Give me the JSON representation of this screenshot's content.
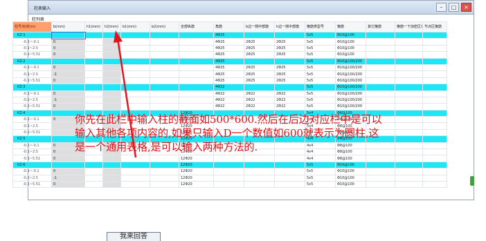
{
  "window": {
    "title": "柱表输入"
  },
  "table_caption": "柱列表",
  "columns": [
    "柱号/标高(m)",
    "b(mm)",
    "h1(mm)",
    "h2(mm)",
    "b1(mm)",
    "b2(mm)",
    "全部纵筋",
    "角筋",
    "b边一侧中部筋",
    "h边一侧中部筋",
    "箍筋类型号",
    "箍筋",
    "其它箍筋",
    "箍筋一下加密区长度",
    "节点区箍筋"
  ],
  "rows": [
    {
      "type": "group",
      "name": "KZ-1",
      "cells": [
        "",
        "",
        "",
        "",
        "",
        "",
        "4Φ25",
        "",
        "",
        "5x5",
        "Φ10@100"
      ]
    },
    {
      "type": "child",
      "name": "-0.1~-0.1",
      "cells": [
        "0",
        "",
        "",
        "",
        "",
        "",
        "4Φ25",
        "2Φ25",
        "2Φ25",
        "5x5",
        "Φ10@100"
      ]
    },
    {
      "type": "child",
      "name": "-0.1~2.5",
      "cells": [
        "0",
        "",
        "",
        "",
        "",
        "",
        "4Φ25",
        "2Φ25",
        "2Φ25",
        "5x5",
        "Φ10@100"
      ]
    },
    {
      "type": "child",
      "name": "-0.1~5.51",
      "cells": [
        "0",
        "",
        "",
        "",
        "",
        "",
        "4Φ25",
        "2Φ25",
        "2Φ25",
        "5x5",
        "Φ10@100"
      ]
    },
    {
      "type": "group",
      "name": "KZ-2",
      "cells": [
        "",
        "",
        "",
        "",
        "",
        "",
        "4Φ25",
        "",
        "",
        "5x5",
        "Φ10@100/200"
      ]
    },
    {
      "type": "child",
      "name": "-0.1~-0.1",
      "cells": [
        "0",
        "",
        "",
        "",
        "",
        "",
        "4Φ25",
        "2Φ25",
        "2Φ25",
        "5x5",
        "Φ10@100/200"
      ]
    },
    {
      "type": "child",
      "name": "-0.1~2.5",
      "cells": [
        "-1",
        "",
        "",
        "",
        "",
        "",
        "4Φ25",
        "2Φ25",
        "2Φ25",
        "5x5",
        "Φ10@100/200"
      ]
    },
    {
      "type": "child",
      "name": "-0.1~5.51",
      "cells": [
        "0",
        "",
        "",
        "",
        "",
        "",
        "4Φ25",
        "2Φ25",
        "2Φ25",
        "5x5",
        "Φ10@100/200"
      ]
    },
    {
      "type": "group",
      "name": "KZ-3",
      "cells": [
        "",
        "",
        "",
        "",
        "",
        "",
        "4Φ22",
        "",
        "",
        "5x5",
        "Φ10@100/200"
      ]
    },
    {
      "type": "child",
      "name": "-0.1~-0.1",
      "cells": [
        "0",
        "",
        "",
        "",
        "",
        "",
        "4Φ22",
        "2Φ22",
        "2Φ22",
        "5x5",
        "Φ10@100/200"
      ]
    },
    {
      "type": "child",
      "name": "-0.1~2.5",
      "cells": [
        "-1",
        "",
        "",
        "",
        "",
        "",
        "4Φ22",
        "2Φ22",
        "2Φ22",
        "5x5",
        "Φ10@100/200"
      ]
    },
    {
      "type": "child",
      "name": "-0.1~5.51",
      "cells": [
        "0",
        "",
        "",
        "",
        "",
        "",
        "4Φ22",
        "2Φ22",
        "2Φ22",
        "5x5",
        "Φ10@100/200"
      ]
    },
    {
      "type": "group",
      "name": "KZ-4",
      "cells": [
        "",
        "",
        "",
        "",
        "",
        "12Φ20",
        "",
        "",
        "",
        "5x4",
        "Φ8@100"
      ]
    },
    {
      "type": "child",
      "name": "-0.1~-0.1",
      "cells": [
        "0",
        "",
        "",
        "",
        "",
        "12Φ20",
        "",
        "",
        "",
        "5x4",
        "Φ8@100"
      ]
    },
    {
      "type": "child",
      "name": "-0.1~2.5",
      "cells": [
        "",
        "",
        "",
        "",
        "",
        "12Φ20",
        "",
        "",
        "",
        "5x4",
        "Φ8@100"
      ]
    },
    {
      "type": "child",
      "name": "-0.1~5.51",
      "cells": [
        "",
        "",
        "",
        "",
        "",
        "12Φ20",
        "",
        "",
        "",
        "5x4",
        "Φ8@100"
      ]
    },
    {
      "type": "group",
      "name": "KZ-5",
      "cells": [
        "",
        "",
        "",
        "",
        "",
        "12Φ20",
        "",
        "",
        "",
        "4x4",
        "Φ8@100"
      ]
    },
    {
      "type": "child",
      "name": "-0.1~-0.1",
      "cells": [
        "0",
        "",
        "",
        "",
        "",
        "12Φ20",
        "",
        "",
        "",
        "4x4",
        "Φ8@100"
      ]
    },
    {
      "type": "child",
      "name": "-0.1~2.5",
      "cells": [
        "0",
        "",
        "",
        "",
        "",
        "12Φ20",
        "",
        "",
        "",
        "4x4",
        "Φ8@100"
      ]
    },
    {
      "type": "child",
      "name": "-0.1~5.51",
      "cells": [
        "0",
        "",
        "",
        "",
        "",
        "12Φ20",
        "",
        "",
        "",
        "4x4",
        "Φ8@100"
      ]
    },
    {
      "type": "group",
      "name": "KZ-6",
      "cells": [
        "",
        "",
        "",
        "",
        "",
        "12Φ20",
        "",
        "",
        "",
        "5x5",
        "Φ10@100"
      ]
    },
    {
      "type": "child",
      "name": "-0.1~-0.1",
      "cells": [
        "0",
        "",
        "",
        "",
        "",
        "12Φ20",
        "",
        "",
        "",
        "5x5",
        "Φ10@100"
      ]
    },
    {
      "type": "child",
      "name": "-0.1~2.5",
      "cells": [
        "-1",
        "",
        "",
        "",
        "",
        "12Φ20",
        "",
        "",
        "",
        "5x5",
        "Φ10@100"
      ]
    },
    {
      "type": "child",
      "name": "-0.1~5.51",
      "cells": [
        "0",
        "",
        "",
        "",
        "",
        "12Φ20",
        "",
        "",
        "",
        "5x5",
        "Φ10@100"
      ]
    }
  ],
  "annotation": "你先在此栏中输入柱的截面如500*600.然后在后边对应栏中是可以\n输入其他各项内容的,如果只输入D一个数值如600就表示为圆柱,这\n是一个通用表格,是可以输入两种方法的.",
  "bottom_button": "我来回答",
  "colors": {
    "group_row": "#1ee7f5",
    "annotation": "#e0141b",
    "header_first": "#ff9f6b"
  }
}
